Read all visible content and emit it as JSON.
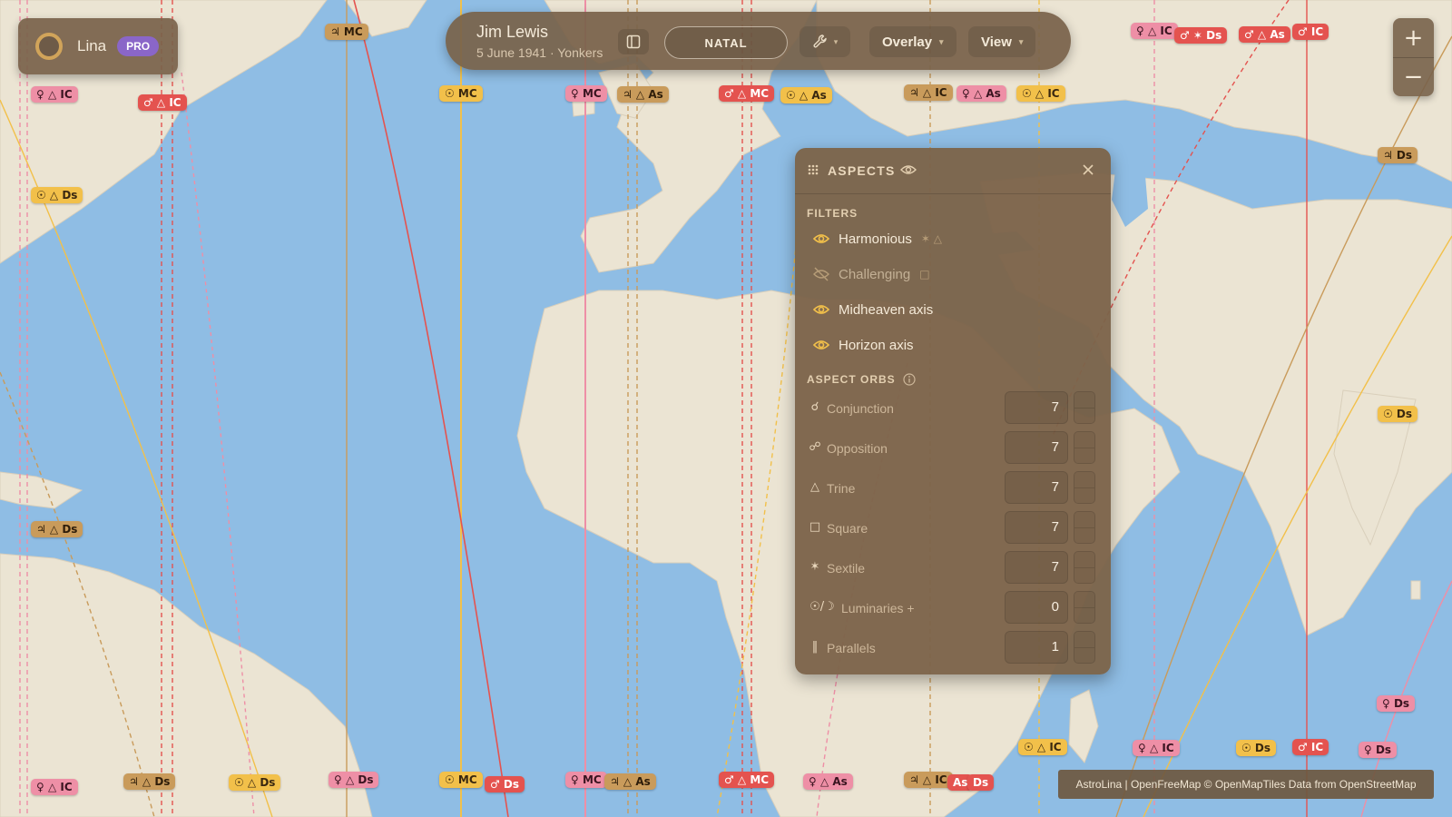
{
  "user": {
    "name": "Lina",
    "plan_badge": "PRO"
  },
  "toolbar": {
    "chart_name": "Jim Lewis",
    "chart_meta": "5 June 1941 · Yonkers",
    "mode": "NATAL",
    "overlay_label": "Overlay",
    "view_label": "View"
  },
  "zoom": {
    "in_label": "+",
    "out_label": "−"
  },
  "aspects_panel": {
    "title": "ASPECTS",
    "filters_heading": "FILTERS",
    "filters": [
      {
        "label": "Harmonious",
        "symbols": "✶ △",
        "enabled": true
      },
      {
        "label": "Challenging",
        "symbols": "□",
        "enabled": false
      },
      {
        "label": "Midheaven axis",
        "symbols": "",
        "enabled": true
      },
      {
        "label": "Horizon axis",
        "symbols": "",
        "enabled": true
      }
    ],
    "orbs_heading": "ASPECT ORBS",
    "orbs": [
      {
        "glyph": "☌",
        "name": "Conjunction",
        "value": "7"
      },
      {
        "glyph": "☍",
        "name": "Opposition",
        "value": "7"
      },
      {
        "glyph": "△",
        "name": "Trine",
        "value": "7"
      },
      {
        "glyph": "□",
        "name": "Square",
        "value": "7"
      },
      {
        "glyph": "✶",
        "name": "Sextile",
        "value": "7"
      },
      {
        "glyph": "☉/☽",
        "name": "Luminaries +",
        "value": "0"
      },
      {
        "glyph": "‖",
        "name": "Parallels",
        "value": "1"
      }
    ]
  },
  "map_labels": [
    {
      "text": "♃ MC",
      "color": "tan"
    },
    {
      "text": "♀ △ IC",
      "color": "pink"
    },
    {
      "text": "♂ △ IC",
      "color": "red"
    },
    {
      "text": "☉ △ Ds",
      "color": "yellow"
    },
    {
      "text": "☉ MC",
      "color": "yellow"
    },
    {
      "text": "♀ MC",
      "color": "pink"
    },
    {
      "text": "♃ △ As",
      "color": "tan"
    },
    {
      "text": "♂ △ MC",
      "color": "red"
    },
    {
      "text": "☉ △ As",
      "color": "yellow"
    },
    {
      "text": "♃ △ IC",
      "color": "tan"
    },
    {
      "text": "♀ △ As",
      "color": "pink"
    },
    {
      "text": "☉ △ IC",
      "color": "yellow"
    },
    {
      "text": "♀ △ IC",
      "color": "pink"
    },
    {
      "text": "♂ ✶ Ds",
      "color": "red"
    },
    {
      "text": "♂ △ As",
      "color": "red"
    },
    {
      "text": "♂ IC",
      "color": "red"
    },
    {
      "text": "♃ Ds",
      "color": "tan"
    },
    {
      "text": "☉ Ds",
      "color": "yellow"
    },
    {
      "text": "♃ △ Ds",
      "color": "tan"
    },
    {
      "text": "♀ Ds",
      "color": "pink"
    },
    {
      "text": "♀ △ IC",
      "color": "pink"
    },
    {
      "text": "♃ △ Ds",
      "color": "tan"
    },
    {
      "text": "☉ △ Ds",
      "color": "yellow"
    },
    {
      "text": "♀ △ Ds",
      "color": "pink"
    },
    {
      "text": "☉ MC",
      "color": "yellow"
    },
    {
      "text": "♂ Ds",
      "color": "red"
    },
    {
      "text": "♀ MC",
      "color": "pink"
    },
    {
      "text": "♃ △ As",
      "color": "tan"
    },
    {
      "text": "♂ △ MC",
      "color": "red"
    },
    {
      "text": "♀ △ As",
      "color": "pink"
    },
    {
      "text": "♃ △ IC",
      "color": "tan"
    },
    {
      "text": "As",
      "color": "red"
    },
    {
      "text": "Ds",
      "color": "red"
    },
    {
      "text": "☉ △ IC",
      "color": "yellow"
    },
    {
      "text": "♀ △ IC",
      "color": "pink"
    },
    {
      "text": "☉ Ds",
      "color": "yellow"
    },
    {
      "text": "♂ IC",
      "color": "red"
    },
    {
      "text": "♀ Ds",
      "color": "pink"
    }
  ],
  "colors": {
    "ocean": "#8fbde4",
    "land": "#ebe4d3",
    "line_red": "#e4534f",
    "line_pink": "#ee8fa6",
    "line_yellow": "#f2c04a",
    "line_tan": "#c99b5b"
  },
  "attribution": "AstroLina | OpenFreeMap © OpenMapTiles Data from OpenStreetMap"
}
